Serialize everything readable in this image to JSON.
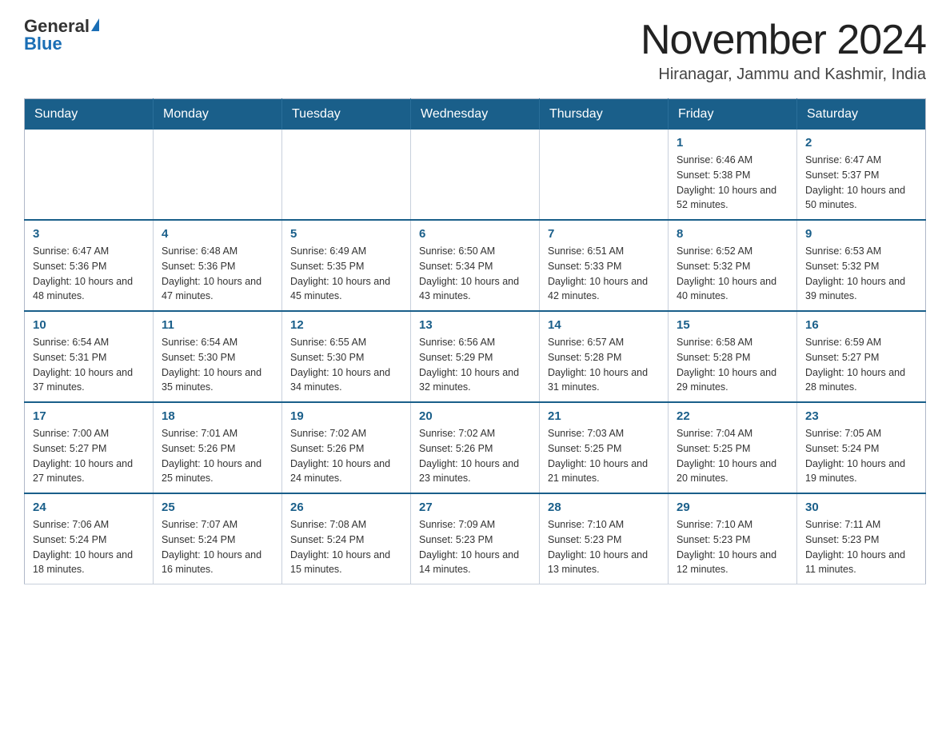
{
  "header": {
    "logo_general": "General",
    "logo_blue": "Blue",
    "calendar_title": "November 2024",
    "calendar_subtitle": "Hiranagar, Jammu and Kashmir, India"
  },
  "days_of_week": [
    "Sunday",
    "Monday",
    "Tuesday",
    "Wednesday",
    "Thursday",
    "Friday",
    "Saturday"
  ],
  "weeks": [
    [
      {
        "day": "",
        "info": ""
      },
      {
        "day": "",
        "info": ""
      },
      {
        "day": "",
        "info": ""
      },
      {
        "day": "",
        "info": ""
      },
      {
        "day": "",
        "info": ""
      },
      {
        "day": "1",
        "info": "Sunrise: 6:46 AM\nSunset: 5:38 PM\nDaylight: 10 hours and 52 minutes."
      },
      {
        "day": "2",
        "info": "Sunrise: 6:47 AM\nSunset: 5:37 PM\nDaylight: 10 hours and 50 minutes."
      }
    ],
    [
      {
        "day": "3",
        "info": "Sunrise: 6:47 AM\nSunset: 5:36 PM\nDaylight: 10 hours and 48 minutes."
      },
      {
        "day": "4",
        "info": "Sunrise: 6:48 AM\nSunset: 5:36 PM\nDaylight: 10 hours and 47 minutes."
      },
      {
        "day": "5",
        "info": "Sunrise: 6:49 AM\nSunset: 5:35 PM\nDaylight: 10 hours and 45 minutes."
      },
      {
        "day": "6",
        "info": "Sunrise: 6:50 AM\nSunset: 5:34 PM\nDaylight: 10 hours and 43 minutes."
      },
      {
        "day": "7",
        "info": "Sunrise: 6:51 AM\nSunset: 5:33 PM\nDaylight: 10 hours and 42 minutes."
      },
      {
        "day": "8",
        "info": "Sunrise: 6:52 AM\nSunset: 5:32 PM\nDaylight: 10 hours and 40 minutes."
      },
      {
        "day": "9",
        "info": "Sunrise: 6:53 AM\nSunset: 5:32 PM\nDaylight: 10 hours and 39 minutes."
      }
    ],
    [
      {
        "day": "10",
        "info": "Sunrise: 6:54 AM\nSunset: 5:31 PM\nDaylight: 10 hours and 37 minutes."
      },
      {
        "day": "11",
        "info": "Sunrise: 6:54 AM\nSunset: 5:30 PM\nDaylight: 10 hours and 35 minutes."
      },
      {
        "day": "12",
        "info": "Sunrise: 6:55 AM\nSunset: 5:30 PM\nDaylight: 10 hours and 34 minutes."
      },
      {
        "day": "13",
        "info": "Sunrise: 6:56 AM\nSunset: 5:29 PM\nDaylight: 10 hours and 32 minutes."
      },
      {
        "day": "14",
        "info": "Sunrise: 6:57 AM\nSunset: 5:28 PM\nDaylight: 10 hours and 31 minutes."
      },
      {
        "day": "15",
        "info": "Sunrise: 6:58 AM\nSunset: 5:28 PM\nDaylight: 10 hours and 29 minutes."
      },
      {
        "day": "16",
        "info": "Sunrise: 6:59 AM\nSunset: 5:27 PM\nDaylight: 10 hours and 28 minutes."
      }
    ],
    [
      {
        "day": "17",
        "info": "Sunrise: 7:00 AM\nSunset: 5:27 PM\nDaylight: 10 hours and 27 minutes."
      },
      {
        "day": "18",
        "info": "Sunrise: 7:01 AM\nSunset: 5:26 PM\nDaylight: 10 hours and 25 minutes."
      },
      {
        "day": "19",
        "info": "Sunrise: 7:02 AM\nSunset: 5:26 PM\nDaylight: 10 hours and 24 minutes."
      },
      {
        "day": "20",
        "info": "Sunrise: 7:02 AM\nSunset: 5:26 PM\nDaylight: 10 hours and 23 minutes."
      },
      {
        "day": "21",
        "info": "Sunrise: 7:03 AM\nSunset: 5:25 PM\nDaylight: 10 hours and 21 minutes."
      },
      {
        "day": "22",
        "info": "Sunrise: 7:04 AM\nSunset: 5:25 PM\nDaylight: 10 hours and 20 minutes."
      },
      {
        "day": "23",
        "info": "Sunrise: 7:05 AM\nSunset: 5:24 PM\nDaylight: 10 hours and 19 minutes."
      }
    ],
    [
      {
        "day": "24",
        "info": "Sunrise: 7:06 AM\nSunset: 5:24 PM\nDaylight: 10 hours and 18 minutes."
      },
      {
        "day": "25",
        "info": "Sunrise: 7:07 AM\nSunset: 5:24 PM\nDaylight: 10 hours and 16 minutes."
      },
      {
        "day": "26",
        "info": "Sunrise: 7:08 AM\nSunset: 5:24 PM\nDaylight: 10 hours and 15 minutes."
      },
      {
        "day": "27",
        "info": "Sunrise: 7:09 AM\nSunset: 5:23 PM\nDaylight: 10 hours and 14 minutes."
      },
      {
        "day": "28",
        "info": "Sunrise: 7:10 AM\nSunset: 5:23 PM\nDaylight: 10 hours and 13 minutes."
      },
      {
        "day": "29",
        "info": "Sunrise: 7:10 AM\nSunset: 5:23 PM\nDaylight: 10 hours and 12 minutes."
      },
      {
        "day": "30",
        "info": "Sunrise: 7:11 AM\nSunset: 5:23 PM\nDaylight: 10 hours and 11 minutes."
      }
    ]
  ]
}
